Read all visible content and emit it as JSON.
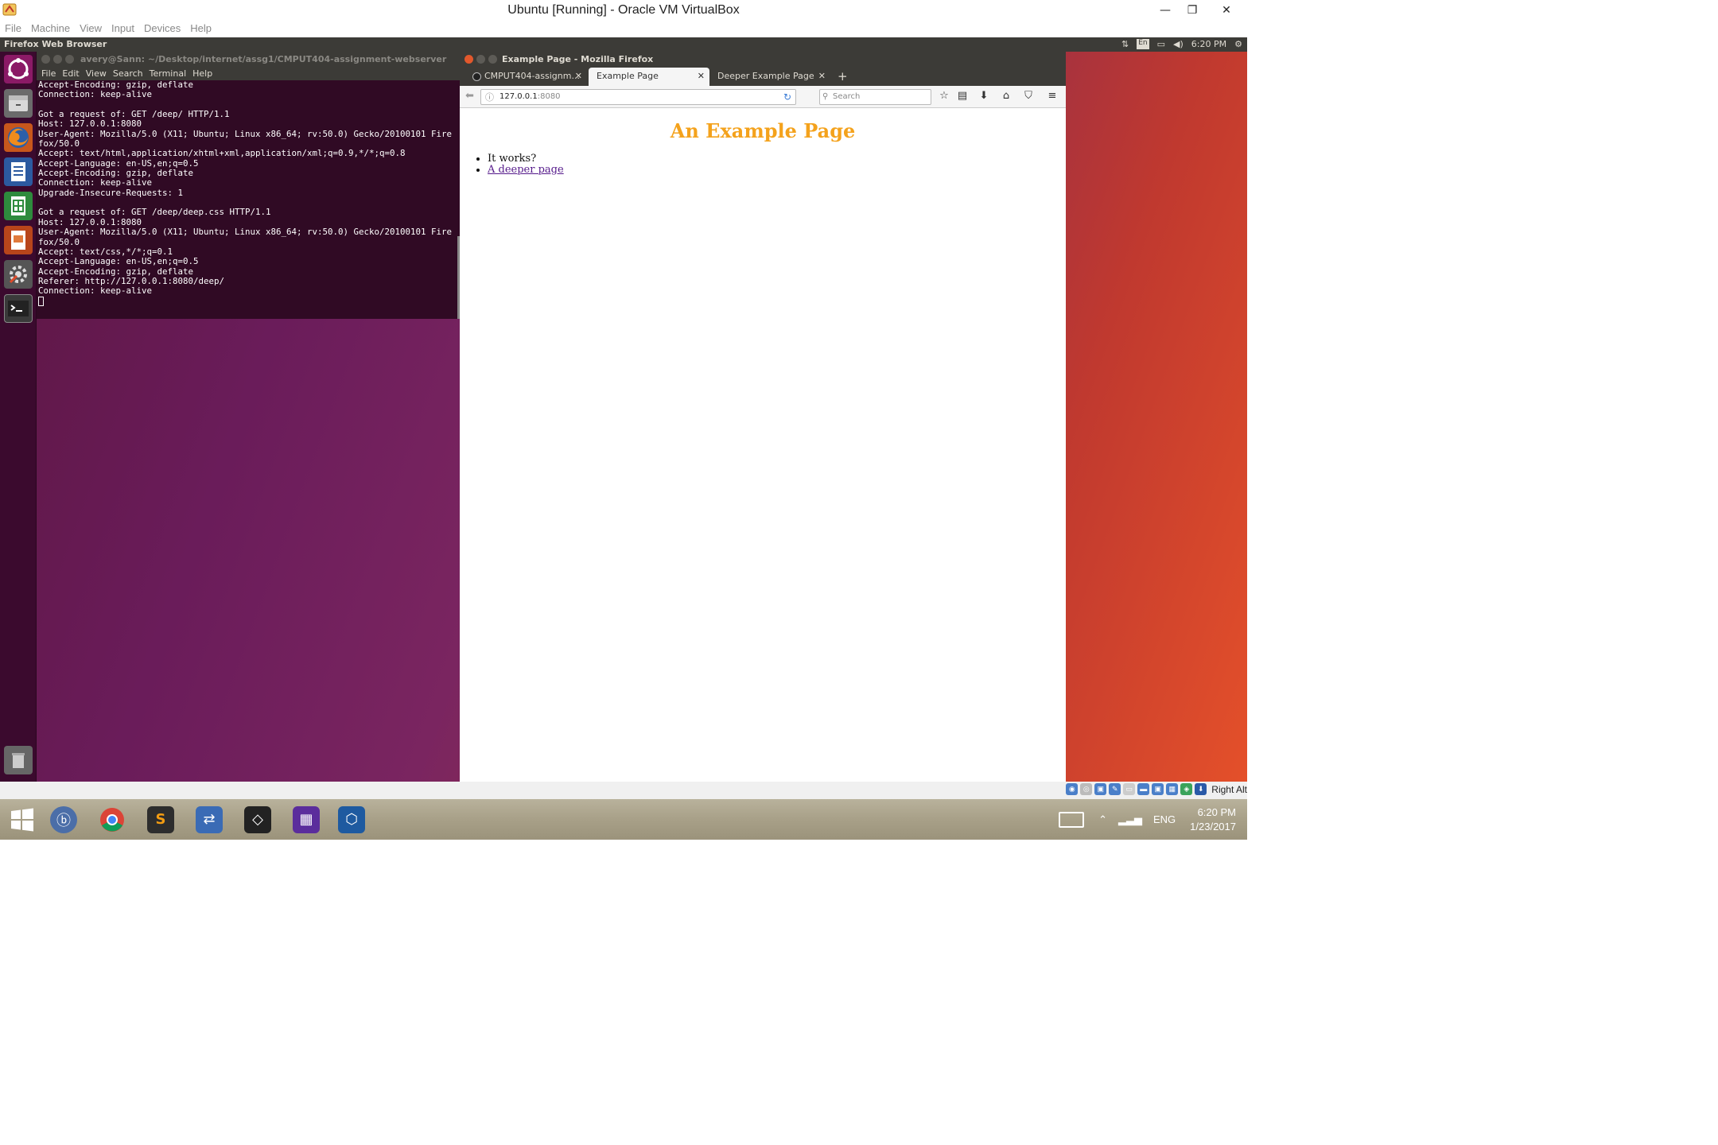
{
  "host": {
    "window_title": "Ubuntu [Running] - Oracle VM VirtualBox",
    "menu": [
      "File",
      "Machine",
      "View",
      "Input",
      "Devices",
      "Help"
    ],
    "status_label": "Right Alt"
  },
  "ubuntu_panel": {
    "app_title": "Firefox Web Browser",
    "keyboard": "En",
    "time": "6:20 PM"
  },
  "launcher": {
    "items": [
      "dash-home",
      "files",
      "firefox",
      "writer",
      "calc",
      "impress",
      "system-settings",
      "terminal"
    ],
    "trash": "trash"
  },
  "terminal": {
    "title": "avery@Sann: ~/Desktop/internet/assg1/CMPUT404-assignment-webserver",
    "menu": [
      "File",
      "Edit",
      "View",
      "Search",
      "Terminal",
      "Help"
    ],
    "output": "Accept-Encoding: gzip, deflate\nConnection: keep-alive\n\nGot a request of: GET /deep/ HTTP/1.1\nHost: 127.0.0.1:8080\nUser-Agent: Mozilla/5.0 (X11; Ubuntu; Linux x86_64; rv:50.0) Gecko/20100101 Fire\nfox/50.0\nAccept: text/html,application/xhtml+xml,application/xml;q=0.9,*/*;q=0.8\nAccept-Language: en-US,en;q=0.5\nAccept-Encoding: gzip, deflate\nConnection: keep-alive\nUpgrade-Insecure-Requests: 1\n\nGot a request of: GET /deep/deep.css HTTP/1.1\nHost: 127.0.0.1:8080\nUser-Agent: Mozilla/5.0 (X11; Ubuntu; Linux x86_64; rv:50.0) Gecko/20100101 Fire\nfox/50.0\nAccept: text/css,*/*;q=0.1\nAccept-Language: en-US,en;q=0.5\nAccept-Encoding: gzip, deflate\nReferer: http://127.0.0.1:8080/deep/\nConnection: keep-alive\n"
  },
  "firefox": {
    "window_title": "Example Page - Mozilla Firefox",
    "tabs": [
      {
        "label": "CMPUT404-assignm..."
      },
      {
        "label": "Example Page"
      },
      {
        "label": "Deeper Example Page"
      }
    ],
    "url_host": "127.0.0.1",
    "url_port": ":8080",
    "search_placeholder": "Search",
    "page": {
      "heading": "An Example Page",
      "items": [
        "It works?",
        "A deeper page"
      ],
      "heading_color": "#f4a21c"
    }
  },
  "taskbar": {
    "apps": [
      "start",
      "bittorrent",
      "chrome",
      "sublime-text",
      "network-tool",
      "unity",
      "calendar-app",
      "virtualbox"
    ],
    "language": "ENG",
    "time": "6:20 PM",
    "date": "1/23/2017"
  }
}
